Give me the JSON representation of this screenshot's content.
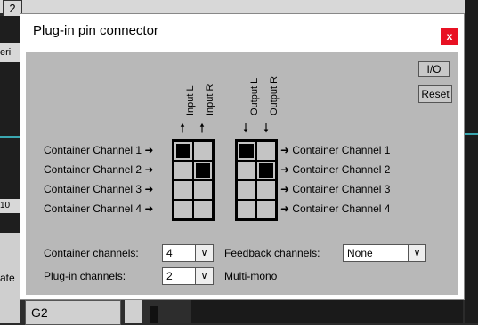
{
  "background": {
    "top_number": "2",
    "left_strip_text": "eri",
    "left_number": "10",
    "left_fragment": "ate",
    "bottom_cell": "G2"
  },
  "dialog": {
    "title": "Plug-in pin connector",
    "close_label": "x",
    "io_label": "I/O",
    "reset_label": "Reset",
    "input_labels": [
      "Input L",
      "Input R"
    ],
    "output_labels": [
      "Output L",
      "Output R"
    ],
    "left_channels": [
      "Container Channel 1",
      "Container Channel 2",
      "Container Channel 3",
      "Container Channel 4"
    ],
    "right_channels": [
      "Container Channel 1",
      "Container Channel 2",
      "Container Channel 3",
      "Container Channel 4"
    ],
    "input_matrix": [
      [
        true,
        false
      ],
      [
        false,
        true
      ],
      [
        false,
        false
      ],
      [
        false,
        false
      ]
    ],
    "output_matrix": [
      [
        true,
        false
      ],
      [
        false,
        true
      ],
      [
        false,
        false
      ],
      [
        false,
        false
      ]
    ],
    "container_channels_label": "Container channels:",
    "container_channels_value": "4",
    "feedback_channels_label": "Feedback channels:",
    "feedback_channels_value": "None",
    "plugin_channels_label": "Plug-in channels:",
    "plugin_channels_value": "2",
    "multi_mono_label": "Multi-mono",
    "chevron_icon": "chevron-down-icon"
  }
}
